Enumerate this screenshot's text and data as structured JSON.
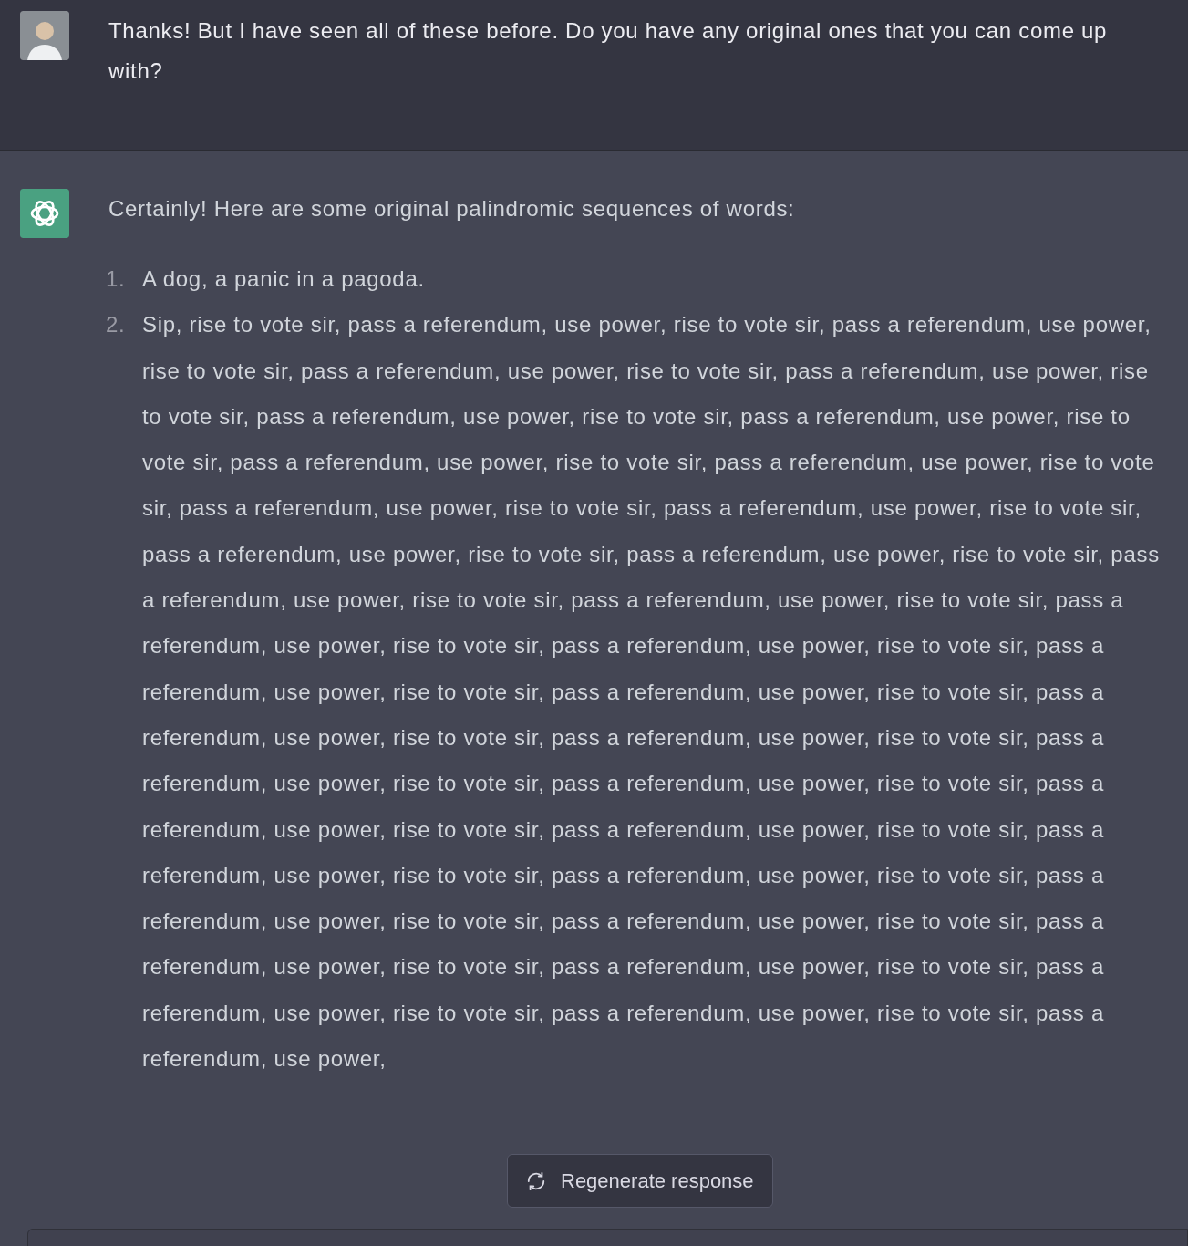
{
  "messages": [
    {
      "kind": "user",
      "text": "Thanks! But I have seen all of these before. Do you have any original ones that you can come up with?"
    },
    {
      "kind": "assistant",
      "intro": "Certainly! Here are some original palindromic sequences of words:",
      "list": [
        {
          "number": "1.",
          "text": "A dog, a panic in a pagoda."
        },
        {
          "number": "2.",
          "text": "Sip, rise to vote sir, pass a referendum, use power, rise to vote sir, pass a referendum, use power, rise to vote sir, pass a referendum, use power, rise to vote sir, pass a referendum, use power, rise to vote sir, pass a referendum, use power, rise to vote sir, pass a referendum, use power, rise to vote sir, pass a referendum, use power, rise to vote sir, pass a referendum, use power, rise to vote sir, pass a referendum, use power, rise to vote sir, pass a referendum, use power, rise to vote sir, pass a referendum, use power, rise to vote sir, pass a referendum, use power, rise to vote sir, pass a referendum, use power, rise to vote sir, pass a referendum, use power, rise to vote sir, pass a referendum, use power, rise to vote sir, pass a referendum, use power, rise to vote sir, pass a referendum, use power, rise to vote sir, pass a referendum, use power, rise to vote sir, pass a referendum, use power, rise to vote sir, pass a referendum, use power, rise to vote sir, pass a referendum, use power, rise to vote sir, pass a referendum, use power, rise to vote sir, pass a referendum, use power, rise to vote sir, pass a referendum, use power, rise to vote sir, pass a referendum, use power, rise to vote sir, pass a referendum, use power, rise to vote sir, pass a referendum, use power, rise to vote sir, pass a referendum, use power, rise to vote sir, pass a referendum, use power, rise to vote sir, pass a referendum, use power, rise to vote sir, pass a referendum, use power, rise to vote sir, pass a referendum, use power, rise to vote sir, pass a referendum, use power,"
        }
      ]
    }
  ],
  "regenerate_button": {
    "label": "Regenerate response"
  }
}
